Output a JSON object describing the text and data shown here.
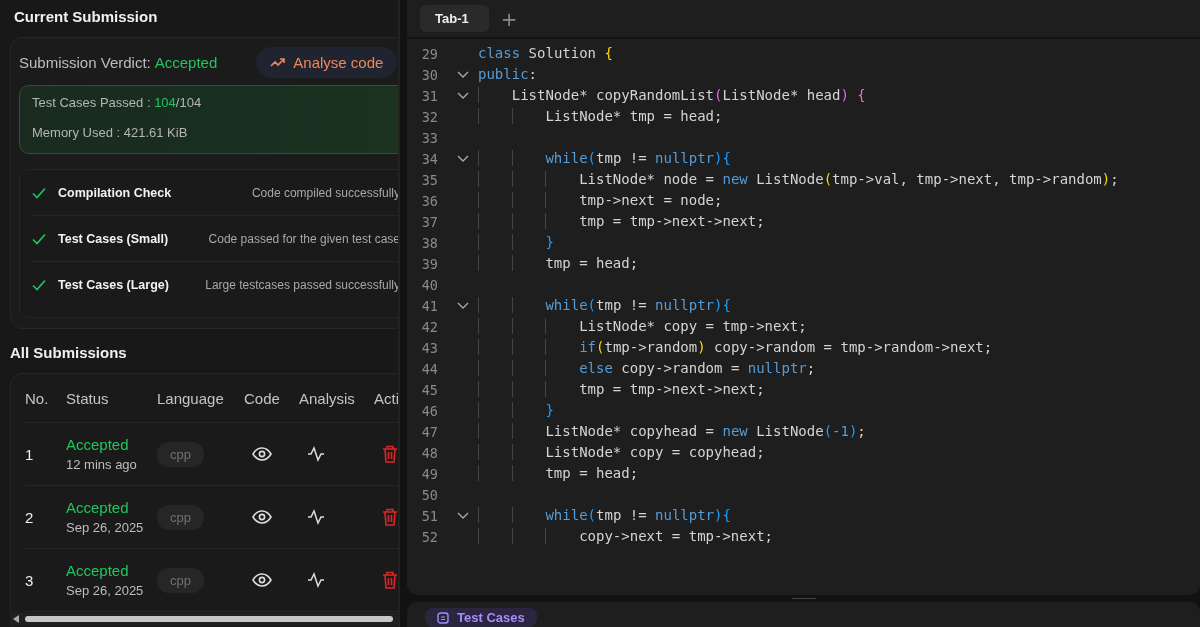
{
  "current_submission": {
    "title": "Current Submission",
    "verdict_label": "Submission Verdict:",
    "verdict": "Accepted",
    "analyse_button": "Analyse code",
    "summary": {
      "passed_label": "Test Cases Passed :",
      "passed": "104",
      "total": "/104",
      "memory": "Memory Used : 421.61 KiB"
    },
    "checks": [
      {
        "name": "Compilation Check",
        "detail": "Code compiled successfully",
        "passed": true
      },
      {
        "name": "Test Cases (Small)",
        "detail": "Code passed for the given test case",
        "passed": true
      },
      {
        "name": "Test Cases (Large)",
        "detail": "Large testcases passed successfully",
        "passed": true
      }
    ]
  },
  "all_submissions": {
    "title": "All Submissions",
    "columns": [
      "No.",
      "Status",
      "Language",
      "Code",
      "Analysis",
      "Acti"
    ],
    "rows": [
      {
        "no": "1",
        "status": "Accepted",
        "time": "12 mins ago",
        "language": "cpp"
      },
      {
        "no": "2",
        "status": "Accepted",
        "time": "Sep 26, 2025",
        "language": "cpp"
      },
      {
        "no": "3",
        "status": "Accepted",
        "time": "Sep 26, 2025",
        "language": "cpp"
      }
    ]
  },
  "editor": {
    "tabs": [
      {
        "label": "Tab-1",
        "selected": true
      }
    ],
    "add_tab": "+",
    "lines": [
      {
        "number": "29",
        "foldable": false,
        "tokens": [
          {
            "kind": "kw",
            "text": "class"
          },
          {
            "kind": "plain",
            "text": " Solution "
          },
          {
            "kind": "b1",
            "text": "{"
          }
        ]
      },
      {
        "number": "30",
        "foldable": true,
        "tokens": [
          {
            "kind": "kw",
            "text": "public"
          },
          {
            "kind": "plain",
            "text": ":"
          }
        ]
      },
      {
        "number": "31",
        "foldable": true,
        "tokens": [
          {
            "kind": "plain",
            "text": "    ListNode* copyRandomList"
          },
          {
            "kind": "b2",
            "text": "("
          },
          {
            "kind": "plain",
            "text": "ListNode* head"
          },
          {
            "kind": "b2",
            "text": ") {"
          }
        ]
      },
      {
        "number": "32",
        "foldable": false,
        "tokens": [
          {
            "kind": "plain",
            "text": "        ListNode* tmp = head;"
          }
        ]
      },
      {
        "number": "33",
        "foldable": false
      },
      {
        "number": "34",
        "foldable": true,
        "tokens": [
          {
            "kind": "kw",
            "text": "        while"
          },
          {
            "kind": "b3",
            "text": "("
          },
          {
            "kind": "plain",
            "text": "tmp != "
          },
          {
            "kind": "kw",
            "text": "nullptr"
          },
          {
            "kind": "b3",
            "text": "){"
          }
        ]
      },
      {
        "number": "35",
        "foldable": false,
        "tokens": [
          {
            "kind": "plain",
            "text": "            ListNode* node = "
          },
          {
            "kind": "kw",
            "text": "new"
          },
          {
            "kind": "plain",
            "text": " ListNode"
          },
          {
            "kind": "b1",
            "text": "("
          },
          {
            "kind": "plain",
            "text": "tmp->val, tmp->next, tmp->random"
          },
          {
            "kind": "b1",
            "text": ")"
          },
          {
            "kind": "plain",
            "text": ";"
          }
        ]
      },
      {
        "number": "36",
        "foldable": false,
        "tokens": [
          {
            "kind": "plain",
            "text": "            tmp->next = node;"
          }
        ]
      },
      {
        "number": "37",
        "foldable": false,
        "tokens": [
          {
            "kind": "plain",
            "text": "            tmp = tmp->next->next;"
          }
        ]
      },
      {
        "number": "38",
        "foldable": false,
        "tokens": [
          {
            "kind": "b3",
            "text": "        }"
          }
        ]
      },
      {
        "number": "39",
        "foldable": false,
        "tokens": [
          {
            "kind": "plain",
            "text": "        tmp = head;"
          }
        ]
      },
      {
        "number": "40",
        "foldable": false
      },
      {
        "number": "41",
        "foldable": true,
        "tokens": [
          {
            "kind": "kw",
            "text": "        while"
          },
          {
            "kind": "b3",
            "text": "("
          },
          {
            "kind": "plain",
            "text": "tmp != "
          },
          {
            "kind": "kw",
            "text": "nullptr"
          },
          {
            "kind": "b3",
            "text": "){"
          }
        ]
      },
      {
        "number": "42",
        "foldable": false,
        "tokens": [
          {
            "kind": "plain",
            "text": "            ListNode* copy = tmp->next;"
          }
        ]
      },
      {
        "number": "43",
        "foldable": false,
        "tokens": [
          {
            "kind": "kw",
            "text": "            if"
          },
          {
            "kind": "b1",
            "text": "("
          },
          {
            "kind": "plain",
            "text": "tmp->random"
          },
          {
            "kind": "b1",
            "text": ")"
          },
          {
            "kind": "plain",
            "text": " copy->random = tmp->random->next;"
          }
        ]
      },
      {
        "number": "44",
        "foldable": false,
        "tokens": [
          {
            "kind": "kw",
            "text": "            else"
          },
          {
            "kind": "plain",
            "text": " copy->random = "
          },
          {
            "kind": "kw",
            "text": "nullptr"
          },
          {
            "kind": "plain",
            "text": ";"
          }
        ]
      },
      {
        "number": "45",
        "foldable": false,
        "tokens": [
          {
            "kind": "plain",
            "text": "            tmp = tmp->next->next;"
          }
        ]
      },
      {
        "number": "46",
        "foldable": false,
        "tokens": [
          {
            "kind": "b3",
            "text": "        }"
          }
        ]
      },
      {
        "number": "47",
        "foldable": false,
        "tokens": [
          {
            "kind": "plain",
            "text": "        ListNode* copyhead = "
          },
          {
            "kind": "kw",
            "text": "new"
          },
          {
            "kind": "plain",
            "text": " ListNode"
          },
          {
            "kind": "b3",
            "text": "("
          },
          {
            "kind": "num",
            "text": "-1"
          },
          {
            "kind": "b3",
            "text": ")"
          },
          {
            "kind": "plain",
            "text": ";"
          }
        ]
      },
      {
        "number": "48",
        "foldable": false,
        "tokens": [
          {
            "kind": "plain",
            "text": "        ListNode* copy = copyhead;"
          }
        ]
      },
      {
        "number": "49",
        "foldable": false,
        "tokens": [
          {
            "kind": "plain",
            "text": "        tmp = head;"
          }
        ]
      },
      {
        "number": "50",
        "foldable": false
      },
      {
        "number": "51",
        "foldable": true,
        "tokens": [
          {
            "kind": "kw",
            "text": "        while"
          },
          {
            "kind": "b3",
            "text": "("
          },
          {
            "kind": "plain",
            "text": "tmp != "
          },
          {
            "kind": "kw",
            "text": "nullptr"
          },
          {
            "kind": "b3",
            "text": "){"
          }
        ]
      },
      {
        "number": "52",
        "foldable": false,
        "tokens": [
          {
            "kind": "plain",
            "text": "            copy->next = tmp->next;"
          }
        ]
      }
    ]
  },
  "bottom_panel": {
    "tabs": [
      {
        "label": "Test Cases",
        "selected": true
      }
    ]
  }
}
